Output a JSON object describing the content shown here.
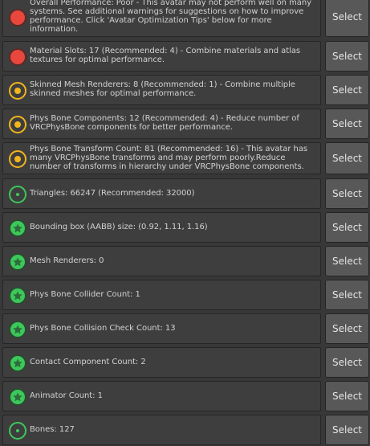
{
  "accent_colors": {
    "error": "#e9473d",
    "warning": "#f2b51c",
    "good": "#3cc85a"
  },
  "rows": [
    {
      "status": "poor",
      "icon": "red-error-icon",
      "text": "Overall Performance: Poor - This avatar may not perform well on many systems. See additional warnings for suggestions on how to improve performance. Click 'Avatar Optimization Tips' below for more information.",
      "button": "Select"
    },
    {
      "status": "poor",
      "icon": "red-error-icon",
      "text": "Material Slots: 17 (Recommended: 4) - Combine materials and atlas textures for optimal performance.",
      "button": "Select"
    },
    {
      "status": "warning",
      "icon": "yellow-warning-icon",
      "text": "Skinned Mesh Renderers: 8 (Recommended: 1) - Combine multiple skinned meshes for optimal performance.",
      "button": "Select"
    },
    {
      "status": "warning",
      "icon": "yellow-warning-icon",
      "text": "Phys Bone Components: 12 (Recommended: 4) - Reduce number of VRCPhysBone components for better performance.",
      "button": "Select"
    },
    {
      "status": "warning",
      "icon": "yellow-warning-icon",
      "text": "Phys Bone Transform Count: 81 (Recommended: 16) - This avatar has many VRCPhysBone transforms and may perform poorly.Reduce number of transforms in hierarchy under VRCPhysBone components.",
      "button": "Select"
    },
    {
      "status": "info",
      "icon": "green-info-icon",
      "text": "Triangles: 66247 (Recommended: 32000)",
      "button": "Select"
    },
    {
      "status": "excellent",
      "icon": "green-star-icon",
      "text": "Bounding box (AABB) size: (0.92, 1.11, 1.16)",
      "button": "Select"
    },
    {
      "status": "excellent",
      "icon": "green-star-icon",
      "text": "Mesh Renderers: 0",
      "button": "Select"
    },
    {
      "status": "excellent",
      "icon": "green-star-icon",
      "text": "Phys Bone Collider Count: 1",
      "button": "Select"
    },
    {
      "status": "excellent",
      "icon": "green-star-icon",
      "text": "Phys Bone Collision Check Count: 13",
      "button": "Select"
    },
    {
      "status": "excellent",
      "icon": "green-star-icon",
      "text": "Contact Component Count: 2",
      "button": "Select"
    },
    {
      "status": "excellent",
      "icon": "green-star-icon",
      "text": "Animator Count: 1",
      "button": "Select"
    },
    {
      "status": "info",
      "icon": "green-info-icon",
      "text": "Bones: 127",
      "button": "Select"
    }
  ]
}
